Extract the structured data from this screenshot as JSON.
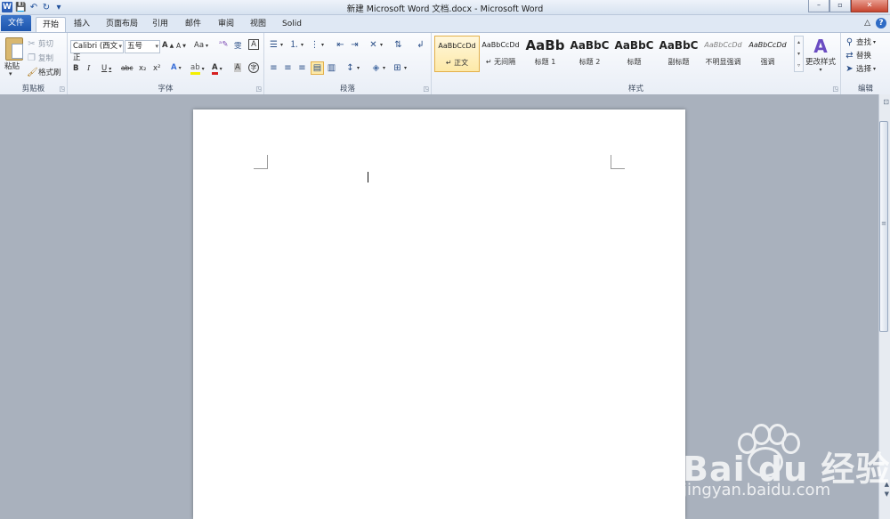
{
  "window": {
    "title": "新建 Microsoft Word 文档.docx - Microsoft Word",
    "minimize": "–",
    "maximize": "▫",
    "close": "✕"
  },
  "qat": {
    "logo": "W",
    "save": "💾",
    "undo": "↶",
    "redo": "↻",
    "customize": "▾"
  },
  "tabs": [
    {
      "label": "文件"
    },
    {
      "label": "开始"
    },
    {
      "label": "插入"
    },
    {
      "label": "页面布局"
    },
    {
      "label": "引用"
    },
    {
      "label": "邮件"
    },
    {
      "label": "审阅"
    },
    {
      "label": "视图"
    },
    {
      "label": "Solid"
    }
  ],
  "tab_right": {
    "collapse": "△",
    "help": "?"
  },
  "clipboard": {
    "group_label": "剪贴板",
    "paste": "粘贴",
    "cut": "剪切",
    "copy": "复制",
    "format_painter": "格式刷"
  },
  "font": {
    "group_label": "字体",
    "font_name": "Calibri (西文正",
    "font_size": "五号",
    "grow": "A",
    "shrink": "A",
    "change_case": "Aa",
    "clear_format": "A",
    "bold": "B",
    "italic": "I",
    "underline": "U",
    "strike": "abc",
    "subscript": "x₂",
    "superscript": "x²",
    "font_color": "A",
    "char_border": "A"
  },
  "paragraph": {
    "group_label": "段落"
  },
  "styles": {
    "group_label": "样式",
    "items": [
      {
        "preview": "AaBbCcDd",
        "name": "正文"
      },
      {
        "preview": "AaBbCcDd",
        "name": "无间隔"
      },
      {
        "preview": "AaBb",
        "name": "标题 1"
      },
      {
        "preview": "AaBbC",
        "name": "标题 2"
      },
      {
        "preview": "AaBbC",
        "name": "标题"
      },
      {
        "preview": "AaBbC",
        "name": "副标题"
      },
      {
        "preview": "AaBbCcDd",
        "name": "不明显强调"
      },
      {
        "preview": "AaBbCcDd",
        "name": "强调"
      }
    ],
    "change_styles": "更改样式"
  },
  "editing": {
    "group_label": "编辑",
    "find": "查找",
    "replace": "替换",
    "select": "选择"
  },
  "watermark": {
    "brand": "Bai du 经验",
    "url": "jingyan.baidu.com"
  },
  "colors": {
    "file_tab": "#2a64bd",
    "selected_style": "#fde9a8",
    "page": "#ffffff",
    "workspace": "#a9b1bd"
  }
}
